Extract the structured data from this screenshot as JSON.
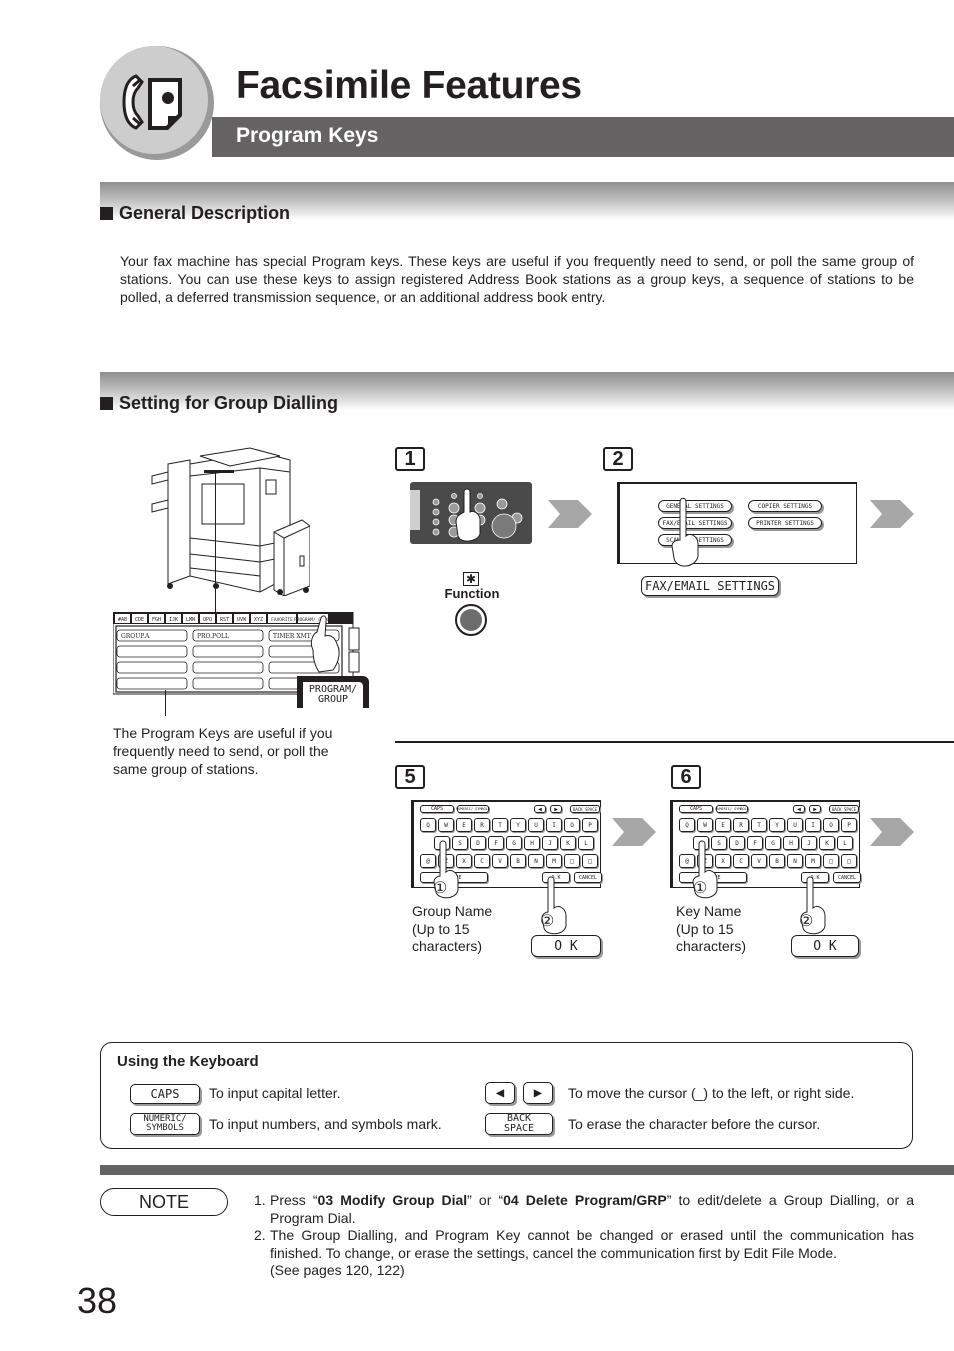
{
  "header": {
    "title": "Facsimile Features",
    "subtitle": "Program Keys",
    "icon": "fax-phone-page-icon"
  },
  "sections": {
    "general": {
      "title": "General Description",
      "body": "Your fax machine has special Program keys. These keys are useful if you frequently need to send, or poll the same group of stations. You can use these keys to assign registered Address Book stations as a group keys, a sequence of stations to be polled, a deferred transmission sequence, or an additional address book entry."
    },
    "group_dialling": {
      "title": "Setting for Group Dialling"
    }
  },
  "illustration": {
    "panel_tabs": [
      "#AB",
      "CDE",
      "FGH",
      "IJK",
      "LMN",
      "OPQ",
      "RST",
      "UVW",
      "XYZ",
      "FAVORITE",
      "PROGRAM/ GROUP"
    ],
    "panel_keys": [
      "GROUP.A",
      "PRO.POLL",
      "TIMER XMT"
    ],
    "program_group_label_1": "PROGRAM/",
    "program_group_label_2": "GROUP",
    "caption": "The Program Keys are useful if you frequently need to send, or poll the same group of stations."
  },
  "steps": [
    {
      "number": "1",
      "star": "✱",
      "label": "Function"
    },
    {
      "number": "2",
      "menu": [
        "GENERAL SETTINGS",
        "COPIER SETTINGS",
        "FAX/EMAIL SETTINGS",
        "PRINTER SETTINGS",
        "SCANNER SETTINGS"
      ],
      "button": "FAX/EMAIL SETTINGS"
    },
    {
      "number": "5",
      "caption": [
        "Group Name",
        "(Up to 15",
        "characters)"
      ],
      "ok": "O K",
      "mark1": "①",
      "mark2": "②"
    },
    {
      "number": "6",
      "caption": [
        "Key Name",
        "(Up to 15",
        "characters)"
      ],
      "ok": "O K",
      "mark1": "①",
      "mark2": "②"
    }
  ],
  "keyboard": {
    "top_row": [
      "CAPS",
      "NUMERIC/ SYMBOLS",
      "◀",
      "▶",
      "BACK SPACE"
    ],
    "row1": [
      "Q",
      "W",
      "E",
      "R",
      "T",
      "Y",
      "U",
      "I",
      "O",
      "P"
    ],
    "row2": [
      "A",
      "S",
      "D",
      "F",
      "G",
      "H",
      "J",
      "K",
      "L"
    ],
    "row3": [
      "@",
      "Z",
      "X",
      "C",
      "V",
      "B",
      "N",
      "M",
      "□",
      "□"
    ],
    "bottom": [
      "SPACE",
      "O.K",
      "CANCEL"
    ]
  },
  "using_keyboard": {
    "title": "Using the Keyboard",
    "items": [
      {
        "key": "CAPS",
        "desc": "To input capital letter."
      },
      {
        "key1": "NUMERIC/",
        "key2": "SYMBOLS",
        "desc": "To input numbers, and symbols mark."
      },
      {
        "left": "◀",
        "right": "▶",
        "desc": "To move the cursor (_) to the left, or right side."
      },
      {
        "key1": "BACK",
        "key2": "SPACE",
        "desc": "To erase the character before the cursor."
      }
    ]
  },
  "note": {
    "label": "NOTE",
    "items": [
      {
        "num": "1.",
        "pre": "Press “",
        "b1": "03 Modify Group Dial",
        "mid": "” or “",
        "b2": "04 Delete Program/GRP",
        "post": "” to edit/delete a Group Dialling, or a Program Dial."
      },
      {
        "num": "2.",
        "text": "The Group Dialling, and Program Key cannot be changed or erased until the communication has finished. To change, or erase the settings, cancel the communication first by Edit File Mode.",
        "ref": "(See pages 120, 122)"
      }
    ]
  },
  "page_number": "38"
}
